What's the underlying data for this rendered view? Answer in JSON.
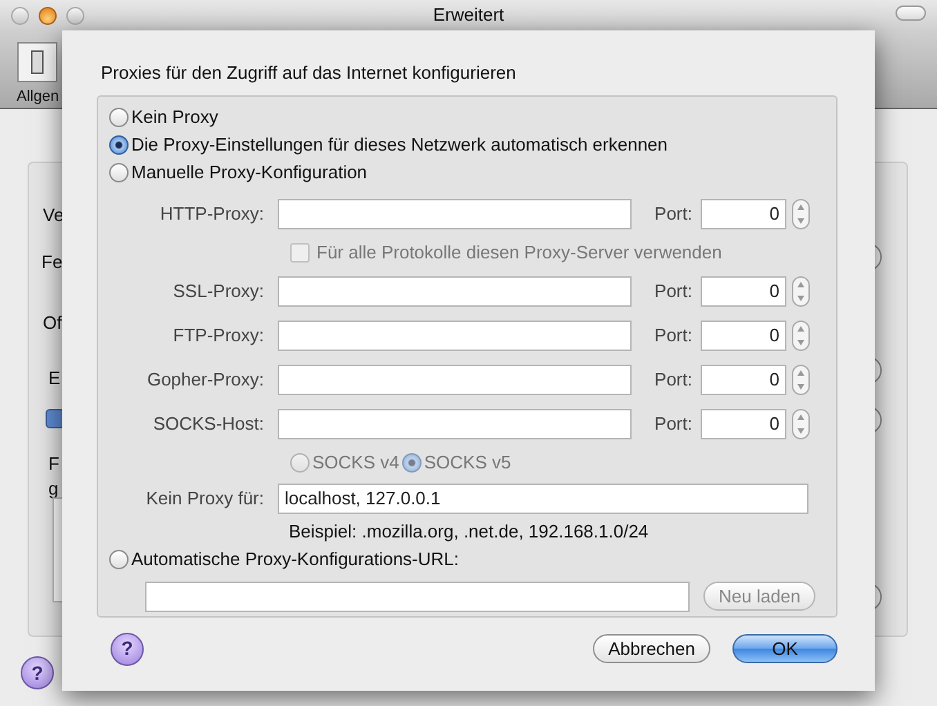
{
  "background_window": {
    "title": "Erweitert",
    "toolbar_label": "Allgen",
    "fragments": [
      "Ve",
      "Fe",
      "Of",
      "E",
      "F",
      "g"
    ],
    "checkbox_checked": true,
    "help_label": "?"
  },
  "dialog": {
    "heading": "Proxies für den Zugriff auf das Internet konfigurieren",
    "proxy_modes": [
      {
        "label": "Kein Proxy",
        "selected": false
      },
      {
        "label": "Die Proxy-Einstellungen für dieses Netzwerk automatisch erkennen",
        "selected": true
      },
      {
        "label": "Manuelle Proxy-Konfiguration",
        "selected": false
      },
      {
        "label": "Automatische Proxy-Konfigurations-URL:",
        "selected": false
      }
    ],
    "proxies": [
      {
        "label": "HTTP-Proxy:",
        "port_label": "Port:",
        "port": "0"
      },
      {
        "label": "SSL-Proxy:",
        "port_label": "Port:",
        "port": "0"
      },
      {
        "label": "FTP-Proxy:",
        "port_label": "Port:",
        "port": "0"
      },
      {
        "label": "Gopher-Proxy:",
        "port_label": "Port:",
        "port": "0"
      },
      {
        "label": "SOCKS-Host:",
        "port_label": "Port:",
        "port": "0"
      }
    ],
    "share_all": {
      "label": "Für alle Protokolle diesen Proxy-Server verwenden",
      "checked": false,
      "disabled": true
    },
    "socks_versions": [
      {
        "label": "SOCKS v4",
        "selected": false
      },
      {
        "label": "SOCKS v5",
        "selected": true
      }
    ],
    "no_proxy": {
      "label": "Kein Proxy für:",
      "value": "localhost, 127.0.0.1"
    },
    "example": "Beispiel: .mozilla.org, .net.de, 192.168.1.0/24",
    "reload_button": {
      "label": "Neu laden",
      "disabled": true
    },
    "help_label": "?",
    "buttons": [
      {
        "label": "Abbrechen",
        "default": false
      },
      {
        "label": "OK",
        "default": true
      }
    ]
  }
}
